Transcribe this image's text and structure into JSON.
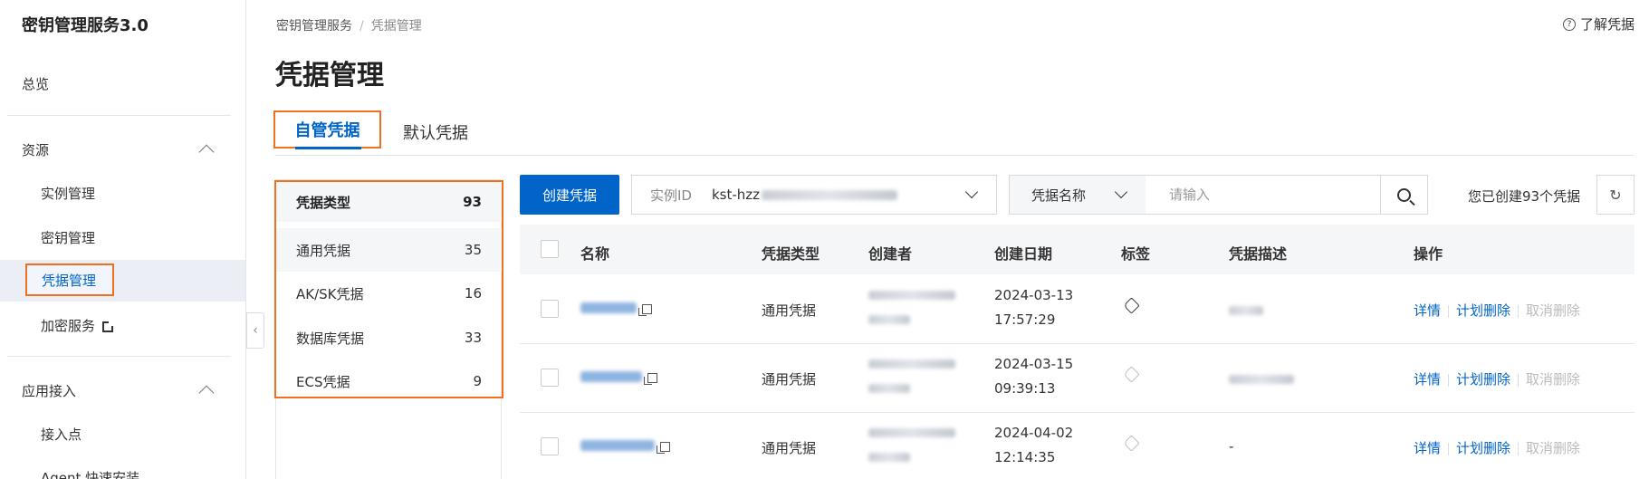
{
  "sidebar": {
    "title": "密钥管理服务3.0",
    "overview": "总览",
    "resources": {
      "label": "资源",
      "items": [
        "实例管理",
        "密钥管理",
        "凭据管理",
        "加密服务"
      ]
    },
    "access": {
      "label": "应用接入",
      "items": [
        "接入点",
        "Agent 快速安装"
      ]
    }
  },
  "breadcrumb": [
    "密钥管理服务",
    "凭据管理"
  ],
  "help_link": "了解凭据",
  "page_title": "凭据管理",
  "tabs": [
    "自管凭据",
    "默认凭据"
  ],
  "type_panel": {
    "header": {
      "label": "凭据类型",
      "count": "93"
    },
    "items": [
      {
        "label": "通用凭据",
        "count": "35"
      },
      {
        "label": "AK/SK凭据",
        "count": "16"
      },
      {
        "label": "数据库凭据",
        "count": "33"
      },
      {
        "label": "ECS凭据",
        "count": "9"
      }
    ]
  },
  "toolbar": {
    "create_button": "创建凭据",
    "instance_label": "实例ID",
    "instance_value": "kst-hzz",
    "search_field": "凭据名称",
    "search_placeholder": "请输入",
    "count_text": "您已创建93个凭据"
  },
  "table": {
    "columns": [
      "名称",
      "凭据类型",
      "创建者",
      "创建日期",
      "标签",
      "凭据描述",
      "操作"
    ],
    "rows": [
      {
        "type": "通用凭据",
        "date": "2024-03-13",
        "time": "17:57:29",
        "description": ""
      },
      {
        "type": "通用凭据",
        "date": "2024-03-15",
        "time": "09:39:13",
        "description": ""
      },
      {
        "type": "通用凭据",
        "date": "2024-04-02",
        "time": "12:14:35",
        "description": "-"
      }
    ],
    "actions": {
      "detail": "详情",
      "schedule_delete": "计划删除",
      "cancel_delete": "取消删除"
    }
  }
}
